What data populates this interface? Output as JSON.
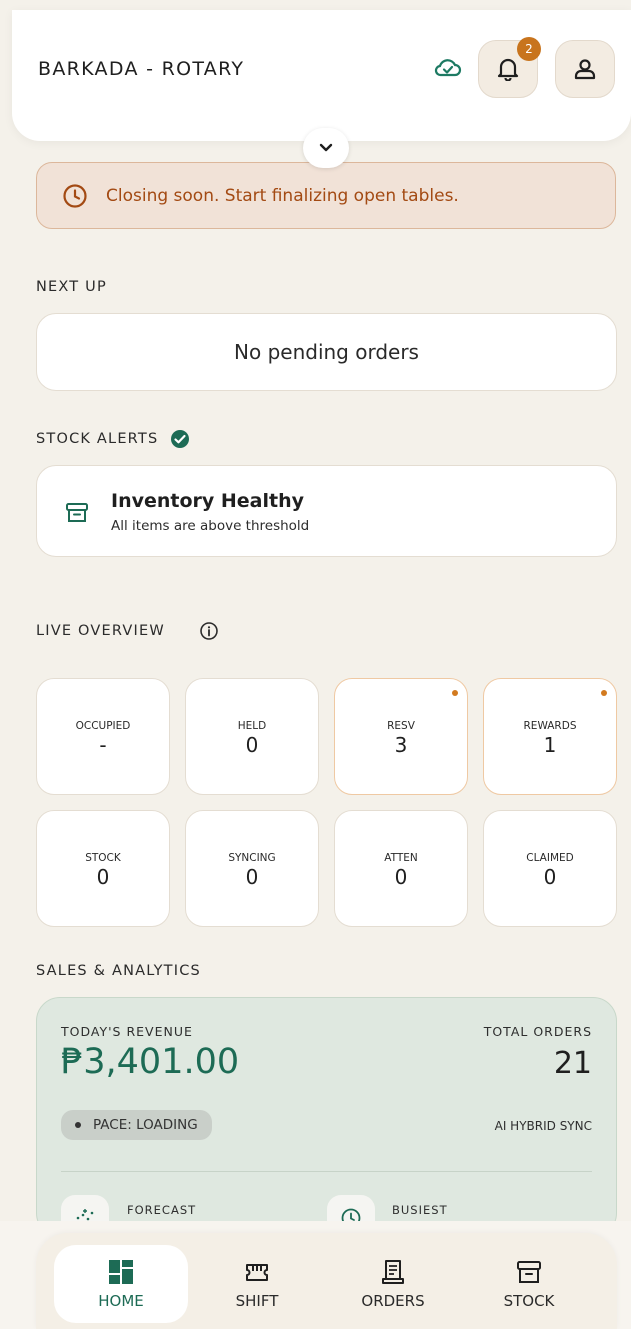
{
  "header": {
    "title": "BARKADA - ROTARY",
    "notification_count": "2"
  },
  "alert": {
    "message": "Closing soon. Start finalizing open tables."
  },
  "next_up": {
    "label": "NEXT UP",
    "empty_text": "No pending orders"
  },
  "stock_alerts": {
    "label": "STOCK ALERTS",
    "title": "Inventory Healthy",
    "subtitle": "All items are above threshold"
  },
  "live_overview": {
    "label": "LIVE OVERVIEW",
    "tiles": [
      {
        "label": "OCCUPIED",
        "value": "-"
      },
      {
        "label": "HELD",
        "value": "0"
      },
      {
        "label": "RESV",
        "value": "3"
      },
      {
        "label": "REWARDS",
        "value": "1"
      },
      {
        "label": "STOCK",
        "value": "0"
      },
      {
        "label": "SYNCING",
        "value": "0"
      },
      {
        "label": "ATTEN",
        "value": "0"
      },
      {
        "label": "CLAIMED",
        "value": "0"
      }
    ]
  },
  "sales": {
    "label": "SALES & ANALYTICS",
    "revenue_label": "TODAY'S REVENUE",
    "revenue_value": "₱3,401.00",
    "orders_label": "TOTAL ORDERS",
    "orders_value": "21",
    "pace": "PACE: LOADING",
    "sync": "AI HYBRID SYNC",
    "forecast_label": "FORECAST",
    "busiest_label": "BUSIEST"
  },
  "nav": {
    "items": [
      {
        "label": "HOME"
      },
      {
        "label": "SHIFT"
      },
      {
        "label": "ORDERS"
      },
      {
        "label": "STOCK"
      }
    ]
  },
  "colors": {
    "accent": "#1d6b55",
    "warning": "#a34a13",
    "badge": "#c8741d",
    "background": "#f4f1ea"
  }
}
